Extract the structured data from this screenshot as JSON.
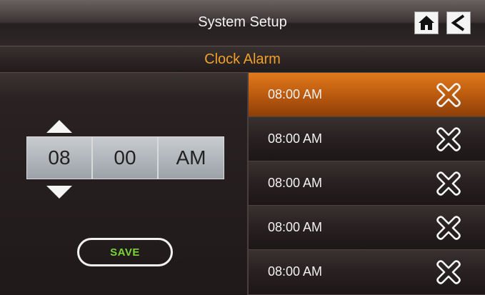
{
  "header": {
    "title": "System Setup",
    "home_icon": "home-icon",
    "back_icon": "back-arrow-icon"
  },
  "sub_header": {
    "title": "Clock Alarm"
  },
  "time_picker": {
    "hour": "08",
    "minute": "00",
    "period": "AM",
    "up_icon": "triangle-up-icon",
    "down_icon": "triangle-down-icon"
  },
  "save_button": {
    "label": "SAVE"
  },
  "alarms": [
    {
      "time": "08:00 AM",
      "selected": true,
      "delete_icon": "close-icon"
    },
    {
      "time": "08:00 AM",
      "selected": false,
      "delete_icon": "close-icon"
    },
    {
      "time": "08:00 AM",
      "selected": false,
      "delete_icon": "close-icon"
    },
    {
      "time": "08:00 AM",
      "selected": false,
      "delete_icon": "close-icon"
    },
    {
      "time": "08:00 AM",
      "selected": false,
      "delete_icon": "close-icon"
    }
  ],
  "colors": {
    "accent_orange": "#f0a028",
    "selected_row": "#c05e10",
    "save_text": "#7cd23a"
  }
}
